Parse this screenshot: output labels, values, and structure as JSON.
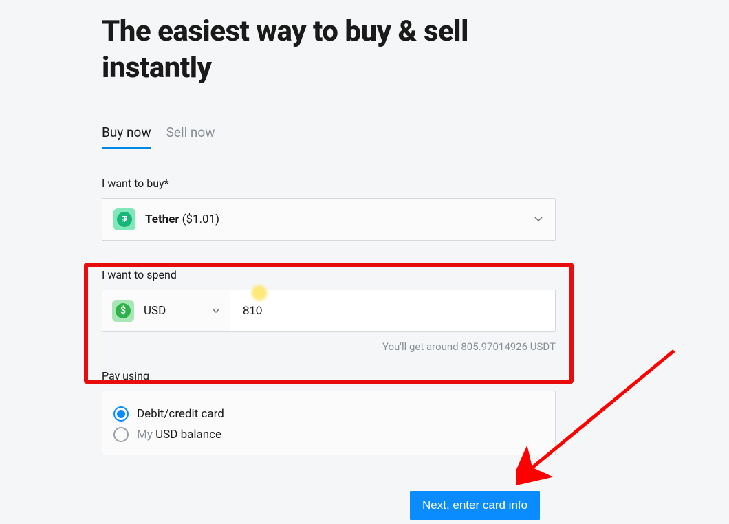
{
  "title": "The easiest way to buy & sell instantly",
  "tabs": {
    "buy": "Buy now",
    "sell": "Sell now",
    "active": "buy"
  },
  "buy_section": {
    "label": "I want to buy*",
    "coin_name": "Tether",
    "coin_price": "($1.01)",
    "coin_symbol_glyph": "₮"
  },
  "spend_section": {
    "label": "I want to spend",
    "currency_label": "USD",
    "currency_glyph": "$",
    "amount_value": "810",
    "estimate_text": "You'll get around 805.97014926 USDT"
  },
  "pay_section": {
    "label": "Pay using",
    "option_card": "Debit/credit card",
    "option_balance_prefix": "My ",
    "option_balance_currency": "USD balance",
    "selected": "card"
  },
  "next_button": "Next, enter card info"
}
